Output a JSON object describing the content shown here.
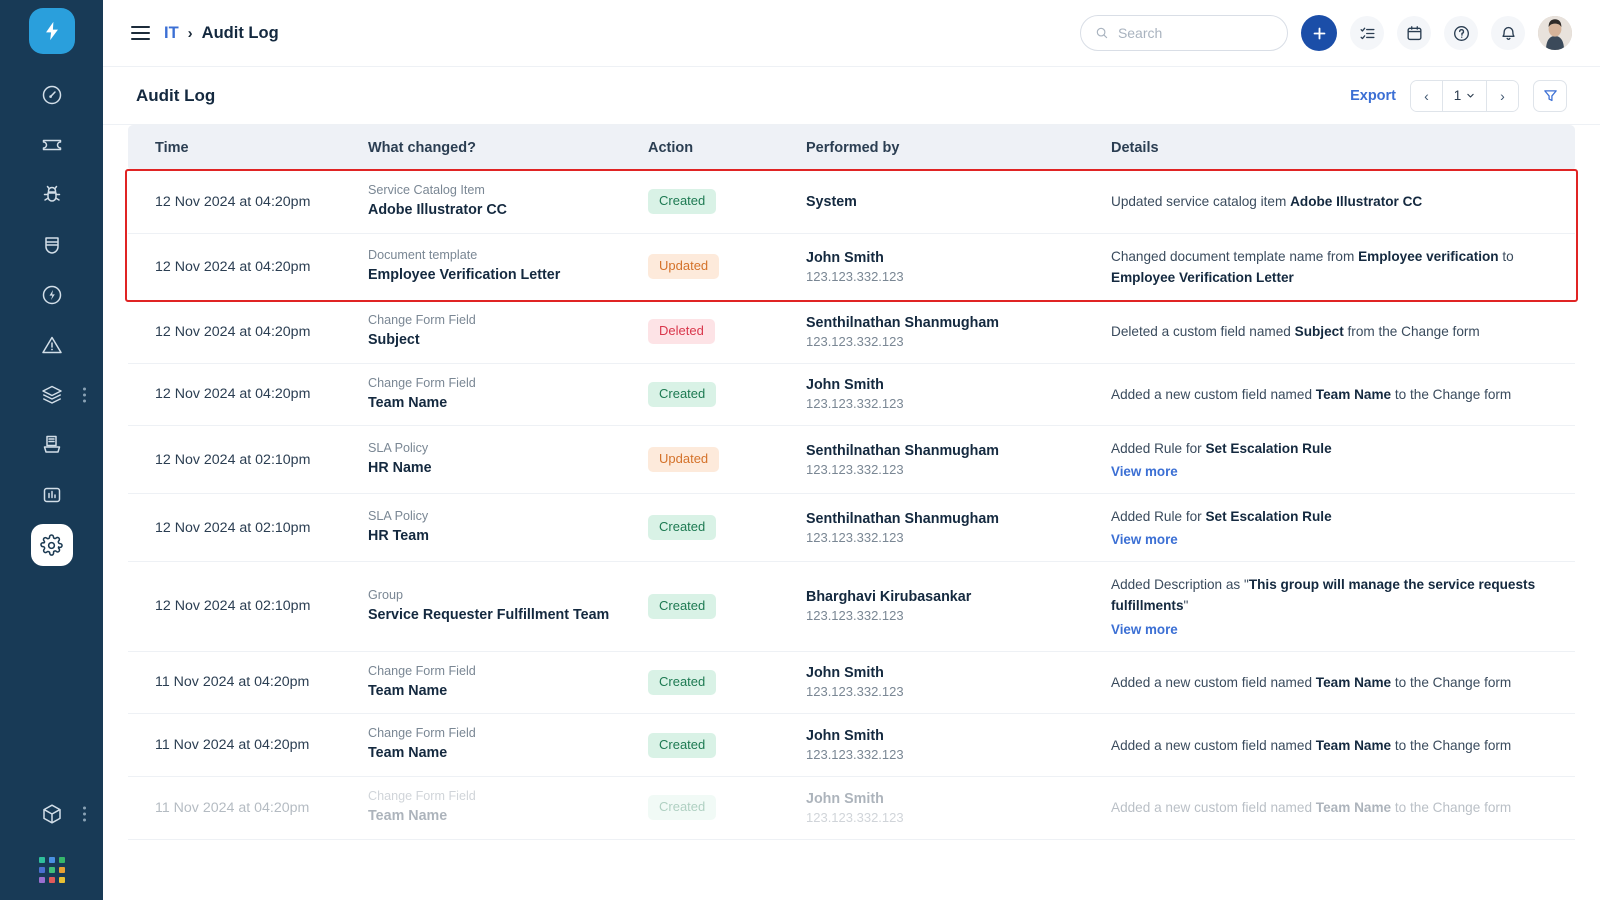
{
  "sidebar": {
    "logo": {
      "name": "app-logo",
      "icon": "lightning-bolt-icon"
    },
    "items": [
      {
        "icon": "gauge-icon",
        "label": "Dashboard",
        "active": false,
        "dots": false
      },
      {
        "icon": "ticket-icon",
        "label": "Tickets",
        "active": false,
        "dots": false
      },
      {
        "icon": "bug-icon",
        "label": "Problems",
        "active": false,
        "dots": false
      },
      {
        "icon": "shield-icon",
        "label": "Assets",
        "active": false,
        "dots": false
      },
      {
        "icon": "power-circle-icon",
        "label": "Changes",
        "active": false,
        "dots": false
      },
      {
        "icon": "alert-triangle-icon",
        "label": "Releases",
        "active": false,
        "dots": false
      },
      {
        "icon": "layers-icon",
        "label": "Projects",
        "active": false,
        "dots": true
      },
      {
        "icon": "knowledge-base-icon",
        "label": "Knowledge Base",
        "active": false,
        "dots": false
      },
      {
        "icon": "analytics-icon",
        "label": "Analytics",
        "active": false,
        "dots": false
      },
      {
        "icon": "gear-icon",
        "label": "Admin",
        "active": true,
        "dots": false
      }
    ],
    "bottom_items": [
      {
        "icon": "cube-icon",
        "label": "Marketplace",
        "dots": true
      },
      {
        "icon": "app-grid-icon",
        "label": "Switch product",
        "dots": false
      }
    ],
    "grid_colors": [
      "#2fbf9b",
      "#4a90e2",
      "#35b66a",
      "#4a6fd0",
      "#3fbf7a",
      "#e8a033",
      "#9a6fd0",
      "#e05a5a",
      "#e8c033"
    ],
    "colors": {
      "bg": "#183a56",
      "logo_bg": "#2a9fdc",
      "active_bg": "#ffffff"
    }
  },
  "topbar": {
    "menu_icon": "hamburger-icon",
    "breadcrumb": {
      "root": "IT",
      "separator": "›",
      "current": "Audit Log"
    },
    "search": {
      "placeholder": "Search",
      "value": "",
      "icon": "search-icon"
    },
    "actions": [
      {
        "name": "add-button",
        "icon": "plus-icon",
        "primary": true
      },
      {
        "name": "tasks-button",
        "icon": "checklist-icon",
        "primary": false
      },
      {
        "name": "calendar-button",
        "icon": "calendar-icon",
        "primary": false
      },
      {
        "name": "help-button",
        "icon": "question-circle-icon",
        "primary": false
      },
      {
        "name": "notifications-button",
        "icon": "bell-icon",
        "primary": false
      }
    ],
    "avatar": {
      "name": "user-avatar"
    },
    "accent": "#1b4ea8"
  },
  "page": {
    "title": "Audit Log",
    "export_label": "Export",
    "pager": {
      "prev": "‹",
      "next": "›",
      "page": "1",
      "caret": "⌄"
    },
    "filter_icon": "filter-icon"
  },
  "table": {
    "columns": [
      "Time",
      "What changed?",
      "Action",
      "Performed by",
      "Details"
    ],
    "rows": [
      {
        "time": "12 Nov 2024 at 04:20pm",
        "type": "Service Catalog Item",
        "name": "Adobe Illustrator CC",
        "action": "Created",
        "action_kind": "created",
        "performer": "System",
        "ip": "",
        "details_html": "Updated service catalog item <b>Adobe Illustrator CC</b>",
        "view_more": false,
        "highlighted": true
      },
      {
        "time": "12 Nov 2024 at 04:20pm",
        "type": "Document template",
        "name": "Employee Verification Letter",
        "action": "Updated",
        "action_kind": "updated",
        "performer": "John Smith",
        "ip": "123.123.332.123",
        "details_html": "Changed document template name from <b>Employee verification</b> to <b>Employee Verification Letter</b>",
        "view_more": false,
        "highlighted": true
      },
      {
        "time": "12 Nov 2024 at 04:20pm",
        "type": "Change Form Field",
        "name": "Subject",
        "action": "Deleted",
        "action_kind": "deleted",
        "performer": "Senthilnathan Shanmugham",
        "ip": "123.123.332.123",
        "details_html": "Deleted a custom field named <b>Subject</b> from the Change form",
        "view_more": false,
        "highlighted": false
      },
      {
        "time": "12 Nov 2024 at 04:20pm",
        "type": "Change Form Field",
        "name": "Team Name",
        "action": "Created",
        "action_kind": "created",
        "performer": "John Smith",
        "ip": "123.123.332.123",
        "details_html": "Added a new custom field named <b>Team Name</b> to the Change form",
        "view_more": false,
        "highlighted": false
      },
      {
        "time": "12 Nov 2024 at 02:10pm",
        "type": "SLA Policy",
        "name": "HR Name",
        "action": "Updated",
        "action_kind": "updated",
        "performer": "Senthilnathan Shanmugham",
        "ip": "123.123.332.123",
        "details_html": "Added Rule for <b>Set Escalation Rule</b>",
        "view_more": true,
        "view_more_label": "View more",
        "highlighted": false
      },
      {
        "time": "12 Nov 2024 at 02:10pm",
        "type": "SLA Policy",
        "name": "HR Team",
        "action": "Created",
        "action_kind": "created",
        "performer": "Senthilnathan Shanmugham",
        "ip": "123.123.332.123",
        "details_html": "Added Rule for <b>Set Escalation Rule</b>",
        "view_more": true,
        "view_more_label": "View more",
        "highlighted": false
      },
      {
        "time": "12 Nov 2024 at 02:10pm",
        "type": "Group",
        "name": "Service Requester Fulfillment Team",
        "action": "Created",
        "action_kind": "created",
        "performer": "Bharghavi Kirubasankar",
        "ip": "123.123.332.123",
        "details_html": "Added Description as \"<b>This group will manage the service requests fulfillments</b>\"",
        "view_more": true,
        "view_more_label": "View more",
        "highlighted": false
      },
      {
        "time": "11 Nov 2024 at 04:20pm",
        "type": "Change Form Field",
        "name": "Team Name",
        "action": "Created",
        "action_kind": "created",
        "performer": "John Smith",
        "ip": "123.123.332.123",
        "details_html": "Added a new custom field named <b>Team Name</b> to the Change form",
        "view_more": false,
        "highlighted": false
      },
      {
        "time": "11 Nov 2024 at 04:20pm",
        "type": "Change Form Field",
        "name": "Team Name",
        "action": "Created",
        "action_kind": "created",
        "performer": "John Smith",
        "ip": "123.123.332.123",
        "details_html": "Added a new custom field named <b>Team Name</b> to the Change form",
        "view_more": false,
        "highlighted": false
      },
      {
        "time": "11 Nov 2024 at 04:20pm",
        "type": "Change Form Field",
        "name": "Team Name",
        "action": "Created",
        "action_kind": "created",
        "performer": "John Smith",
        "ip": "123.123.332.123",
        "details_html": "Added a new custom field named <b>Team Name</b> to the Change form",
        "view_more": false,
        "highlighted": false,
        "cut_off": true
      }
    ],
    "highlight_color": "#e02424"
  }
}
